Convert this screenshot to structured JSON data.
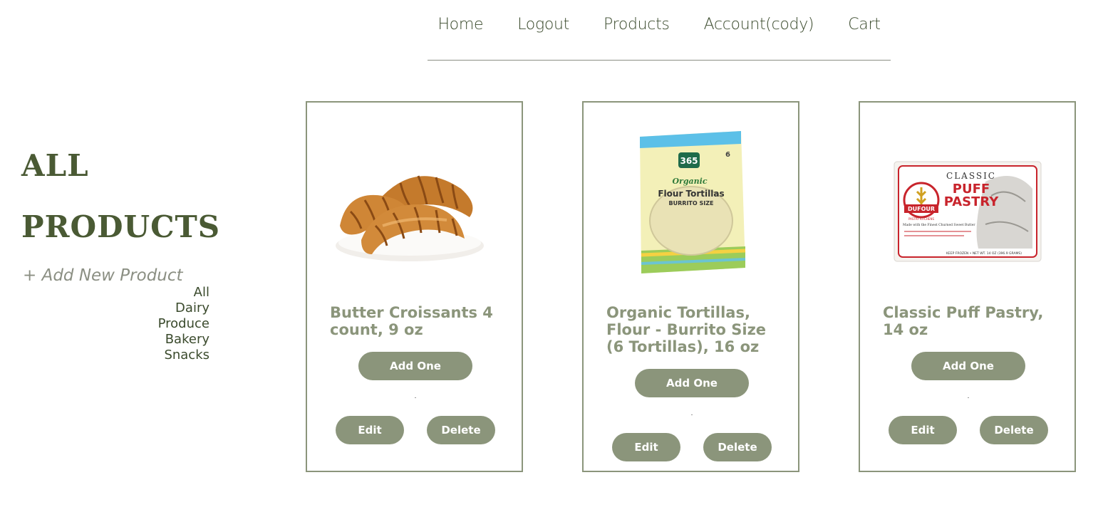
{
  "nav": {
    "items": [
      "Home",
      "Logout",
      "Products",
      "Account(cody)",
      "Cart"
    ]
  },
  "sidebar": {
    "title_line1": "ALL",
    "title_line2": "PRODUCTS",
    "add_new": "+ Add New Product",
    "categories": [
      "All",
      "Dairy",
      "Produce",
      "Bakery",
      "Snacks"
    ]
  },
  "products": [
    {
      "name": "Butter Croissants 4 count, 9 oz",
      "add_label": "Add One",
      "edit_label": "Edit",
      "delete_label": "Delete",
      "image_icon": "croissant-image"
    },
    {
      "name": "Organic Tortillas, Flour - Burrito Size (6 Tortillas), 16 oz",
      "add_label": "Add One",
      "edit_label": "Edit",
      "delete_label": "Delete",
      "image_icon": "tortilla-package-image",
      "pkg": {
        "brand": "365",
        "line1": "Organic",
        "line2": "Flour Tortillas",
        "line3": "BURRITO SIZE",
        "count": "6"
      }
    },
    {
      "name": "Classic Puff Pastry, 14 oz",
      "add_label": "Add One",
      "edit_label": "Edit",
      "delete_label": "Delete",
      "image_icon": "puff-pastry-box-image",
      "pkg": {
        "brand": "DUFOUR",
        "sub": "PASTRY KITCHENS",
        "line1": "CLASSIC",
        "line2": "PUFF",
        "line3": "PASTRY",
        "footer": "KEEP FROZEN • NET WT. 14 OZ (396.9 GRAMS)",
        "tagline": "Made with the Finest Churned Sweet Butter"
      }
    }
  ],
  "colors": {
    "accent": "#8b957b",
    "title": "#4a5a34",
    "text": "#3a4a2c"
  }
}
